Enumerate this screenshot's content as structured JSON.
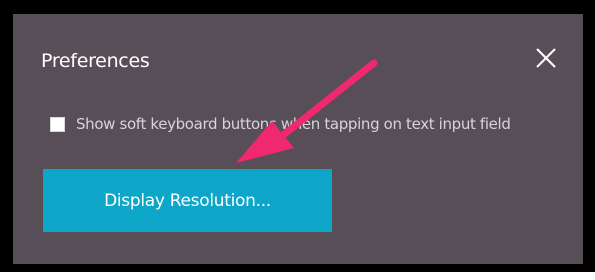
{
  "dialog": {
    "title": "Preferences",
    "close_icon": "close-icon",
    "checkbox": {
      "label": "Show soft keyboard buttons when tapping on text input field",
      "checked": false
    },
    "button_label": "Display Resolution..."
  },
  "colors": {
    "dialog_background": "#574e58",
    "button_background": "#0da6c8",
    "annotation_arrow": "#f0286e"
  },
  "annotation": {
    "arrow_icon": "pointer-arrow-icon"
  }
}
